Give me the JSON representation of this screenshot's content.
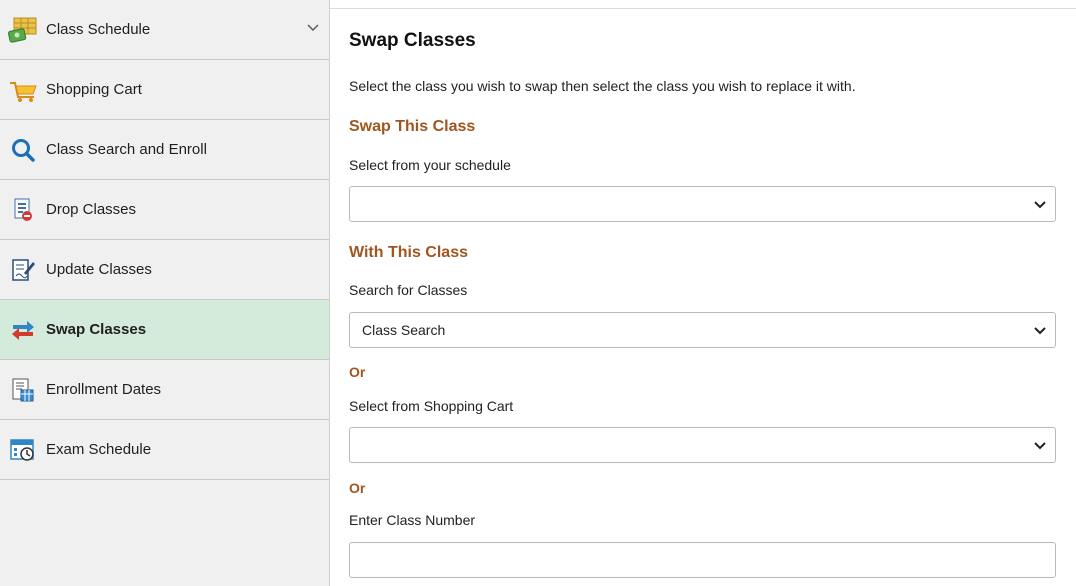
{
  "sidebar": {
    "items": [
      {
        "label": "Class Schedule",
        "icon": "class-schedule-icon",
        "expandable": true
      },
      {
        "label": "Shopping Cart",
        "icon": "shopping-cart-icon"
      },
      {
        "label": "Class Search and Enroll",
        "icon": "search-icon"
      },
      {
        "label": "Drop Classes",
        "icon": "drop-classes-icon"
      },
      {
        "label": "Update Classes",
        "icon": "update-classes-icon"
      },
      {
        "label": "Swap Classes",
        "icon": "swap-icon",
        "active": true
      },
      {
        "label": "Enrollment Dates",
        "icon": "enrollment-dates-icon"
      },
      {
        "label": "Exam Schedule",
        "icon": "exam-schedule-icon"
      }
    ]
  },
  "main": {
    "title": "Swap Classes",
    "instructions": "Select the class you wish to swap then select the class you wish to replace it with.",
    "swap_section": {
      "heading": "Swap This Class",
      "label": "Select from your schedule",
      "selected": ""
    },
    "with_section": {
      "heading": "With This Class",
      "search_label": "Search for Classes",
      "search_selected": "Class Search",
      "or1": "Or",
      "cart_label": "Select from Shopping Cart",
      "cart_selected": "",
      "or2": "Or",
      "number_label": "Enter Class Number",
      "number_value": ""
    }
  },
  "colors": {
    "accent": "#a0561f",
    "active_bg": "#d4ebdc",
    "sidebar_bg": "#f0f0f0"
  }
}
